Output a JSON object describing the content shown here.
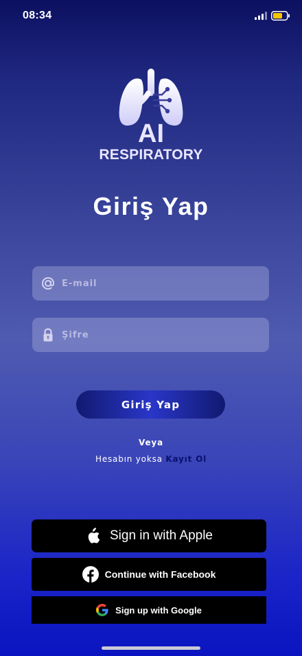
{
  "status_bar": {
    "time": "08:34"
  },
  "logo": {
    "mark": "AI",
    "subtitle": "RESPIRATORY",
    "icon": "lungs-circuit-icon"
  },
  "title": "Giriş Yap",
  "form": {
    "email_placeholder": "E-mail",
    "password_placeholder": "Şifre",
    "login_button": "Giriş Yap"
  },
  "alt": {
    "veya": "Veya",
    "no_account_text": "Hesabın yoksa",
    "register_link": "Kayıt Ol"
  },
  "social": {
    "apple": "Sign in with Apple",
    "facebook": "Continue with Facebook",
    "google": "Sign up with Google"
  },
  "colors": {
    "accent": "#1a24c8",
    "register_link": "#0a1070",
    "social_button_bg": "#000000",
    "battery": "#f5c400"
  }
}
